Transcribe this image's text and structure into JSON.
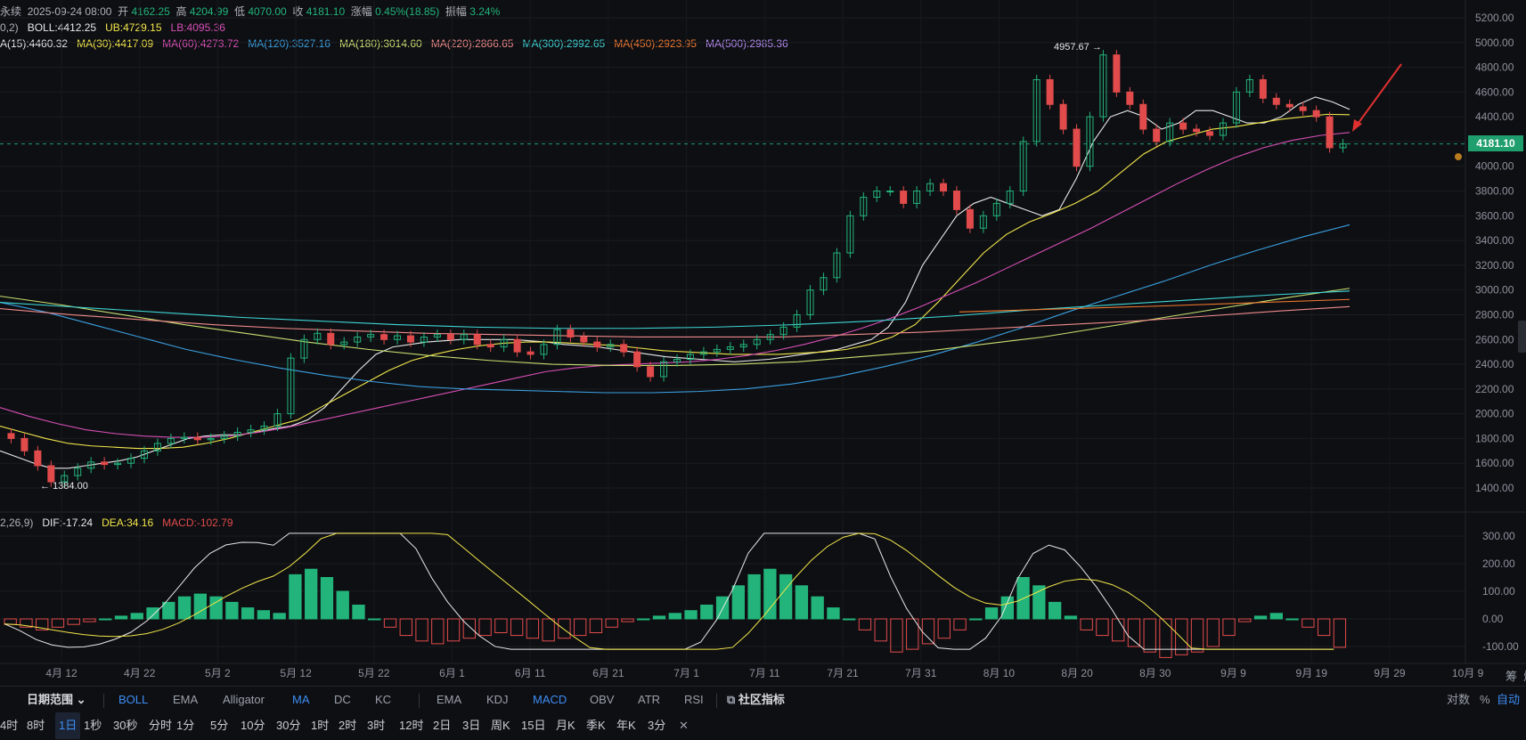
{
  "header": {
    "contract": "永续",
    "datetime": "2025-09-24 08:00",
    "open_label": "开",
    "open": "4162.25",
    "high_label": "高",
    "high": "4204.99",
    "low_label": "低",
    "low": "4070.00",
    "close_label": "收",
    "close": "4181.10",
    "change_label": "涨幅",
    "change": "0.45%(18.85)",
    "amplitude_label": "振幅",
    "amplitude": "3.24%"
  },
  "boll": {
    "param": "0,2)",
    "mid": "BOLL:4412.25",
    "ub": "UB:4729.15",
    "lb": "LB:4095.36"
  },
  "ma_legend": [
    {
      "text": "A(15):4460.32",
      "color": "#e8e8e8"
    },
    {
      "text": "MA(30):4417.09",
      "color": "#f2e64a"
    },
    {
      "text": "MA(60):4273.72",
      "color": "#d84fb6"
    },
    {
      "text": "MA(120):3527.16",
      "color": "#3aa0e0"
    },
    {
      "text": "MA(180):3014.60",
      "color": "#c8e070"
    },
    {
      "text": "MA(220):2866.65",
      "color": "#f08a8a"
    },
    {
      "text": "MA(300):2992.65",
      "color": "#3fd6d6"
    },
    {
      "text": "MA(450):2923.95",
      "color": "#f07a30"
    },
    {
      "text": "MA(500):2985.36",
      "color": "#b58cf0"
    }
  ],
  "macd_legend": {
    "param": "2,26,9)",
    "dif": "DIF:-17.24",
    "dea": "DEA:34.16",
    "macd": "MACD:-102.79"
  },
  "price_marker": "4181.10",
  "high_marker": "4957.67",
  "low_marker": "1384.00",
  "chart_data": {
    "type": "candlestick",
    "interval": "1日",
    "price_axis": {
      "ticks": [
        5200,
        5000,
        4800,
        4600,
        4400,
        4200,
        4000,
        3800,
        3600,
        3400,
        3200,
        3000,
        2800,
        2600,
        2400,
        2200,
        2000,
        1800,
        1600,
        1400
      ],
      "labels": [
        "5200.00",
        "5000.00",
        "4800.00",
        "4600.00",
        "4400.00",
        "4200.00",
        "4000.00",
        "3800.00",
        "3600.00",
        "3400.00",
        "3200.00",
        "3000.00",
        "2800.00",
        "2600.00",
        "2400.00",
        "2200.00",
        "2000.00",
        "1800.00",
        "1600.00",
        "1400.00"
      ]
    },
    "macd_axis": {
      "ticks": [
        300,
        200,
        100,
        0,
        -100
      ],
      "labels": [
        "300.00",
        "200.00",
        "100.00",
        "0.00",
        "-100.00"
      ]
    },
    "date_axis": [
      "4月 12",
      "4月 22",
      "5月 2",
      "5月 12",
      "5月 22",
      "6月 1",
      "6月 11",
      "6月 21",
      "7月 1",
      "7月 11",
      "7月 21",
      "7月 31",
      "8月 10",
      "8月 20",
      "8月 30",
      "9月 9",
      "9月 19",
      "9月 29",
      "10月 9"
    ],
    "series": [
      {
        "name": "price_close",
        "values": [
          1800,
          1700,
          1580,
          1450,
          1500,
          1560,
          1610,
          1590,
          1600,
          1640,
          1700,
          1760,
          1800,
          1810,
          1790,
          1800,
          1820,
          1850,
          1870,
          1900,
          2000,
          2450,
          2600,
          2650,
          2560,
          2580,
          2620,
          2640,
          2600,
          2630,
          2580,
          2620,
          2640,
          2600,
          2640,
          2560,
          2540,
          2600,
          2500,
          2480,
          2560,
          2680,
          2620,
          2580,
          2540,
          2560,
          2500,
          2380,
          2300,
          2420,
          2440,
          2480,
          2500,
          2520,
          2540,
          2560,
          2600,
          2640,
          2700,
          2800,
          3000,
          3100,
          3300,
          3600,
          3750,
          3800,
          3800,
          3700,
          3800,
          3860,
          3800,
          3650,
          3500,
          3600,
          3700,
          3800,
          4200,
          4700,
          4500,
          4300,
          4000,
          4400,
          4900,
          4600,
          4500,
          4300,
          4200,
          4350,
          4300,
          4280,
          4250,
          4350,
          4600,
          4700,
          4550,
          4500,
          4480,
          4450,
          4400,
          4150,
          4181
        ]
      },
      {
        "name": "MA(15)",
        "values": [
          1700,
          1650,
          1600,
          1560,
          1560,
          1580,
          1600,
          1620,
          1650,
          1700,
          1750,
          1800,
          1820,
          1830,
          1830,
          1850,
          1880,
          1900,
          1950,
          2050,
          2200,
          2350,
          2480,
          2540,
          2560,
          2580,
          2590,
          2600,
          2600,
          2600,
          2600,
          2590,
          2580,
          2560,
          2550,
          2540,
          2520,
          2500,
          2480,
          2460,
          2450,
          2440,
          2430,
          2420,
          2430,
          2440,
          2460,
          2480,
          2500,
          2520,
          2560,
          2600,
          2700,
          2900,
          3200,
          3400,
          3600,
          3700,
          3750,
          3700,
          3650,
          3600,
          3650,
          3900,
          4200,
          4400,
          4450,
          4400,
          4300,
          4350,
          4450,
          4450,
          4400,
          4350,
          4350,
          4400,
          4500,
          4560,
          4520,
          4460
        ]
      },
      {
        "name": "MA(30)",
        "values": [
          1900,
          1850,
          1800,
          1760,
          1740,
          1730,
          1720,
          1720,
          1730,
          1760,
          1800,
          1850,
          1900,
          1950,
          2050,
          2150,
          2250,
          2350,
          2430,
          2480,
          2520,
          2550,
          2570,
          2580,
          2580,
          2570,
          2560,
          2550,
          2530,
          2510,
          2500,
          2490,
          2480,
          2480,
          2480,
          2490,
          2500,
          2520,
          2560,
          2620,
          2720,
          2900,
          3100,
          3300,
          3450,
          3550,
          3620,
          3700,
          3800,
          3950,
          4100,
          4200,
          4250,
          4300,
          4320,
          4350,
          4380,
          4400,
          4420,
          4417
        ]
      },
      {
        "name": "MA(60)",
        "values": [
          2050,
          1980,
          1920,
          1870,
          1840,
          1820,
          1810,
          1810,
          1820,
          1850,
          1890,
          1940,
          1990,
          2040,
          2090,
          2140,
          2190,
          2240,
          2290,
          2340,
          2370,
          2390,
          2400,
          2410,
          2420,
          2440,
          2470,
          2510,
          2560,
          2620,
          2690,
          2770,
          2860,
          2960,
          3060,
          3170,
          3280,
          3390,
          3500,
          3620,
          3740,
          3860,
          3970,
          4070,
          4150,
          4210,
          4250,
          4273
        ]
      },
      {
        "name": "MA(120)",
        "values": [
          2900,
          2820,
          2720,
          2620,
          2520,
          2440,
          2370,
          2310,
          2260,
          2220,
          2200,
          2190,
          2180,
          2170,
          2170,
          2180,
          2200,
          2240,
          2300,
          2380,
          2470,
          2580,
          2700,
          2830,
          2950,
          3070,
          3200,
          3320,
          3430,
          3527
        ]
      },
      {
        "name": "MA(180)",
        "values": [
          2950,
          2880,
          2800,
          2720,
          2650,
          2580,
          2520,
          2470,
          2430,
          2400,
          2390,
          2390,
          2400,
          2420,
          2460,
          2500,
          2560,
          2620,
          2700,
          2780,
          2860,
          2940,
          3014
        ]
      },
      {
        "name": "MA(220)",
        "values": [
          2850,
          2800,
          2760,
          2720,
          2690,
          2670,
          2650,
          2640,
          2630,
          2620,
          2620,
          2620,
          2640,
          2660,
          2690,
          2720,
          2750,
          2790,
          2830,
          2866
        ]
      },
      {
        "name": "MA(300)",
        "values": [
          2900,
          2860,
          2820,
          2780,
          2750,
          2720,
          2700,
          2690,
          2690,
          2700,
          2720,
          2750,
          2790,
          2840,
          2880,
          2920,
          2960,
          2992
        ]
      },
      {
        "name": "MACD",
        "values": [
          -20,
          -30,
          -40,
          -30,
          -20,
          -10,
          0,
          10,
          20,
          40,
          60,
          80,
          90,
          80,
          60,
          40,
          30,
          20,
          160,
          180,
          150,
          100,
          50,
          0,
          -30,
          -60,
          -80,
          -90,
          -80,
          -70,
          -60,
          -50,
          -60,
          -70,
          -80,
          -70,
          -60,
          -50,
          -30,
          -10,
          0,
          10,
          20,
          30,
          50,
          80,
          120,
          160,
          180,
          160,
          120,
          80,
          40,
          0,
          -40,
          -80,
          -120,
          -110,
          -90,
          -70,
          -40,
          0,
          40,
          80,
          150,
          120,
          60,
          10,
          -40,
          -60,
          -80,
          -100,
          -120,
          -140,
          -130,
          -120,
          -100,
          -60,
          -10,
          10,
          20,
          0,
          -30,
          -60,
          -103
        ]
      }
    ]
  },
  "toolbar1": {
    "date_range": "日期范围",
    "main_indicators": [
      "BOLL",
      "EMA",
      "Alligator",
      "MA",
      "DC",
      "KC"
    ],
    "sub_indicators": [
      "EMA",
      "KDJ",
      "MACD",
      "OBV",
      "ATR",
      "RSI"
    ],
    "community": "社区指标",
    "right": [
      "对数",
      "%",
      "自动"
    ]
  },
  "toolbar2": {
    "intervals": [
      "4时",
      "8时",
      "1日",
      "1秒",
      "30秒",
      "分时",
      "1分",
      "5分",
      "10分",
      "30分",
      "1时",
      "2时",
      "3时",
      "12时",
      "2日",
      "3日",
      "周K",
      "15日",
      "月K",
      "季K",
      "年K",
      "3分"
    ],
    "active": "1日",
    "close": "✕"
  },
  "right_labels": [
    "筹",
    "爆"
  ]
}
